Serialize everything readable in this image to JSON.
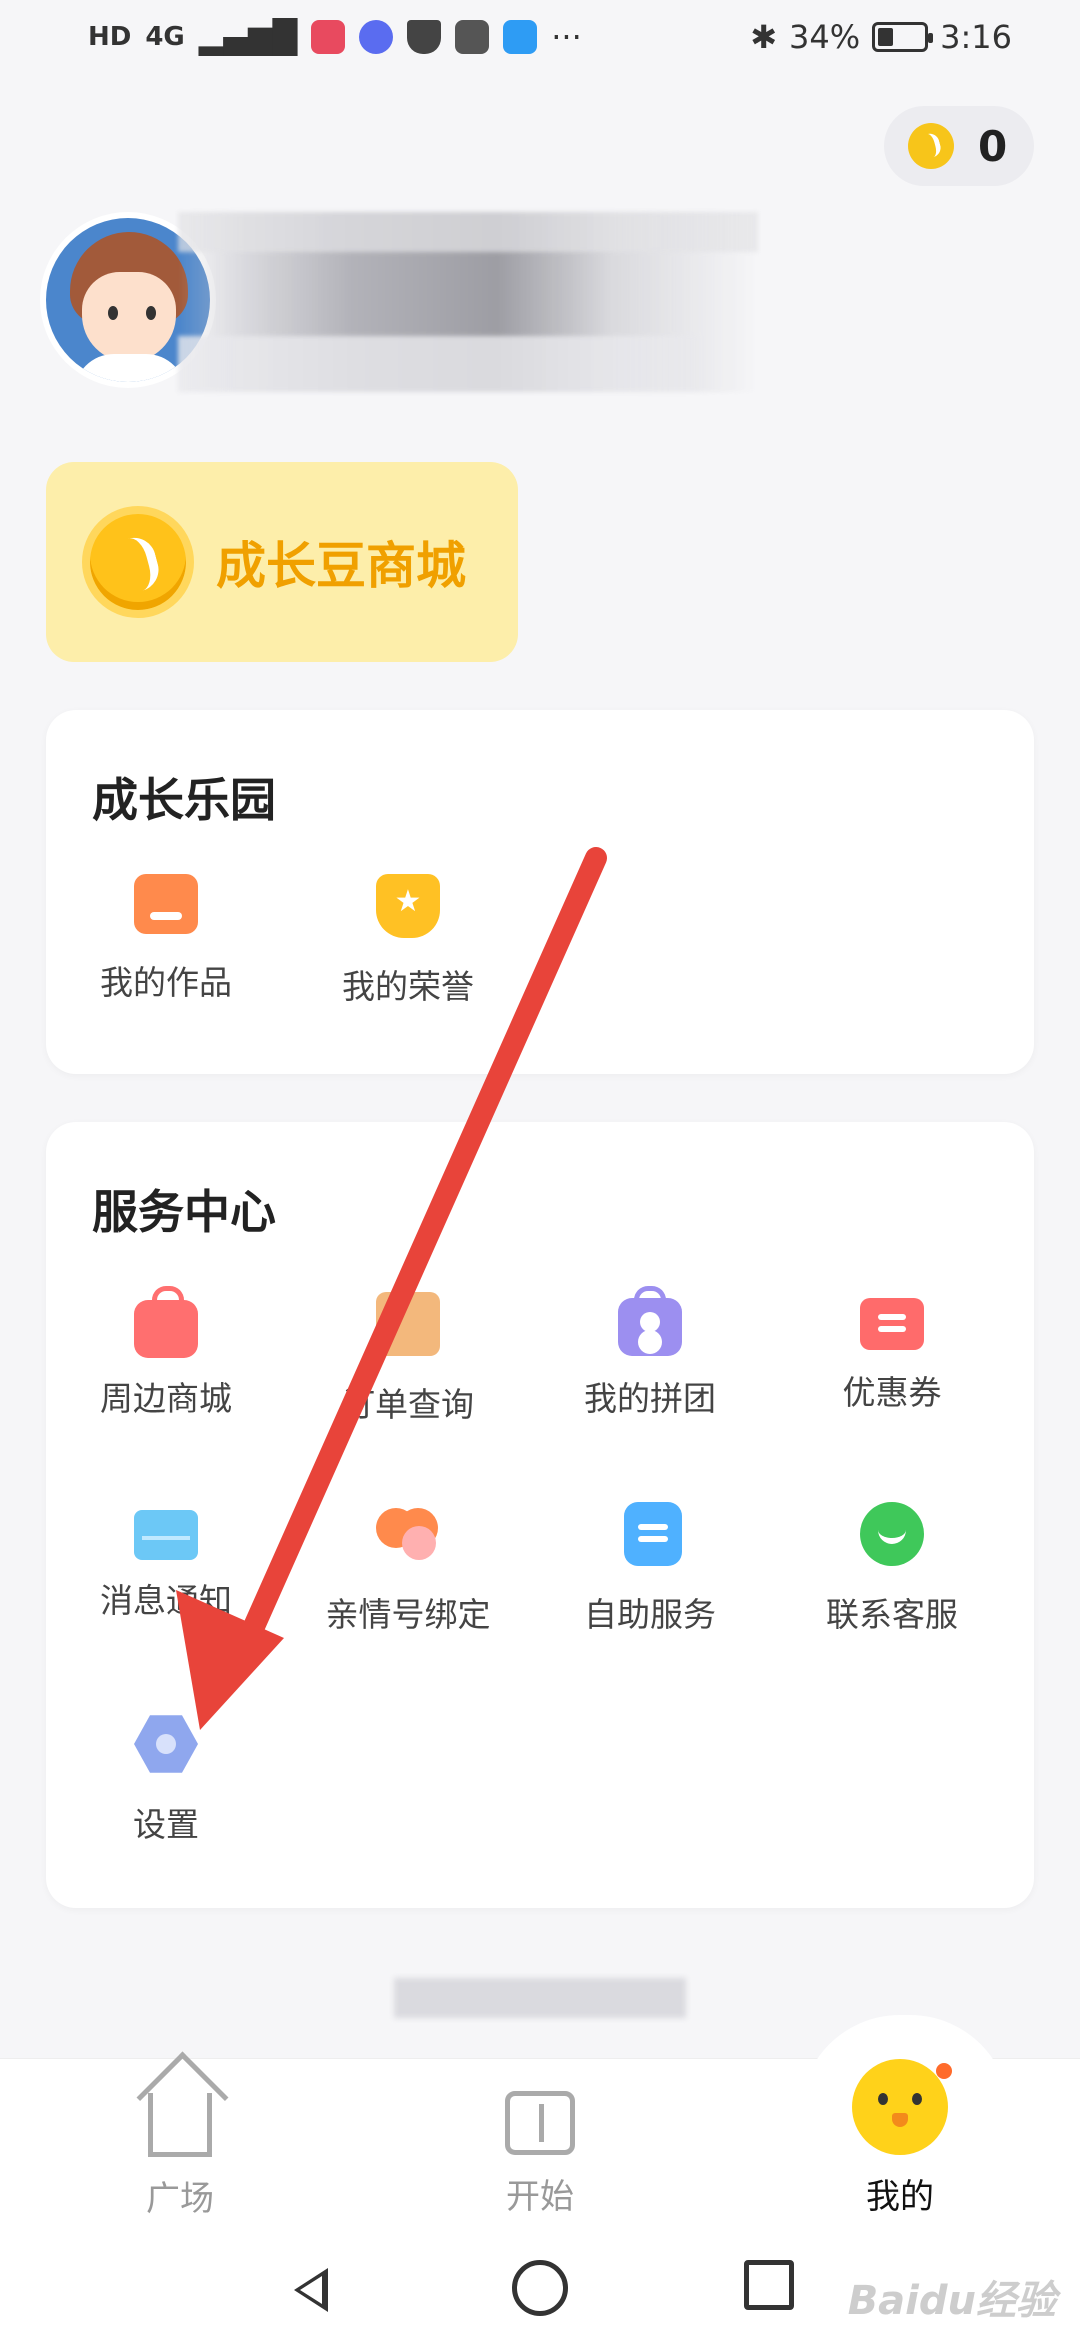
{
  "status_bar": {
    "left_tags": [
      "HD",
      "4G"
    ],
    "battery": "34%",
    "battery_level": 0.34,
    "time": "3:16",
    "more": "···"
  },
  "coins": {
    "count": "0"
  },
  "mall": {
    "title": "成长豆商城"
  },
  "growth_park": {
    "title": "成长乐园",
    "items": [
      {
        "label": "我的作品",
        "icon": "works-icon"
      },
      {
        "label": "我的荣誉",
        "icon": "honor-icon"
      }
    ]
  },
  "service_center": {
    "title": "服务中心",
    "items": [
      {
        "label": "周边商城",
        "icon": "shopping-bag-icon"
      },
      {
        "label": "订单查询",
        "icon": "order-icon"
      },
      {
        "label": "我的拼团",
        "icon": "group-buy-icon"
      },
      {
        "label": "优惠券",
        "icon": "coupon-icon"
      },
      {
        "label": "消息通知",
        "icon": "mail-icon"
      },
      {
        "label": "亲情号绑定",
        "icon": "heart-icon"
      },
      {
        "label": "自助服务",
        "icon": "self-service-icon"
      },
      {
        "label": "联系客服",
        "icon": "chat-icon"
      },
      {
        "label": "设置",
        "icon": "settings-icon"
      }
    ]
  },
  "tabbar": {
    "tabs": [
      {
        "label": "广场",
        "icon": "home-icon",
        "active": false
      },
      {
        "label": "开始",
        "icon": "book-icon",
        "active": false
      },
      {
        "label": "我的",
        "icon": "chick-icon",
        "active": true
      }
    ]
  },
  "watermark": "Baidu经验",
  "colors": {
    "accent": "#f0a000",
    "annotation_arrow": "#e8443a"
  }
}
